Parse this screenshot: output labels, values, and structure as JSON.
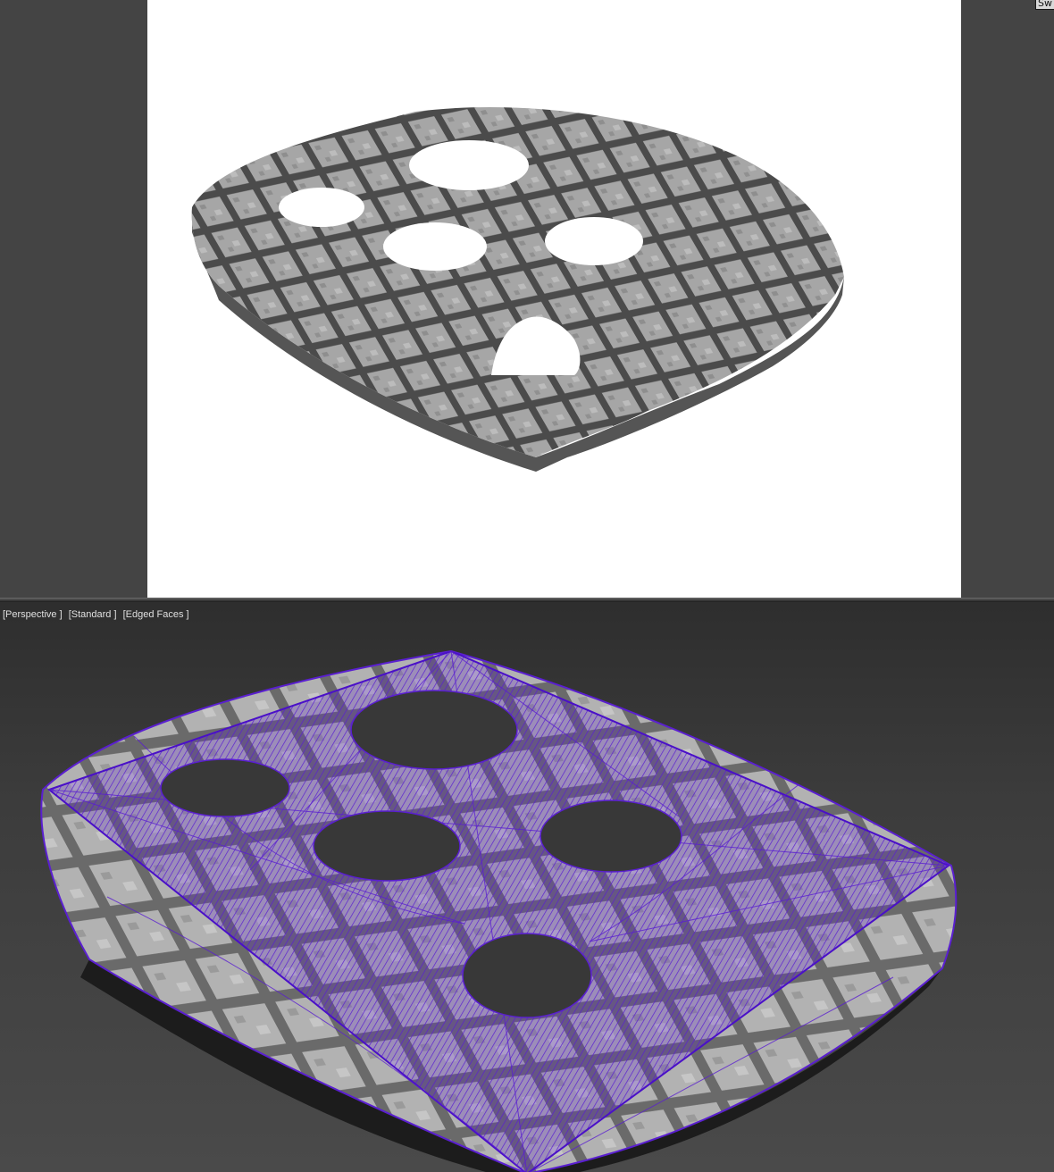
{
  "top_window": {
    "corner_button_label": "Sw"
  },
  "viewport": {
    "labels": [
      "[Perspective ]",
      "[Standard ]",
      "[Edged Faces ]"
    ],
    "wire_color": "#5a1fd0"
  },
  "colors": {
    "render_bg": "#ffffff",
    "viewport_bg": "#3a3a3a",
    "wireframe": "#5a1fd0"
  }
}
